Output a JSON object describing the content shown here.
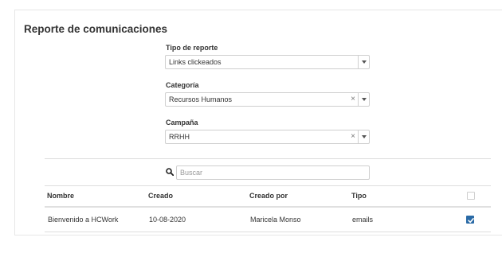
{
  "page": {
    "title": "Reporte de comunicaciones"
  },
  "filters": {
    "report_type": {
      "label": "Tipo de reporte",
      "value": "Links clickeados"
    },
    "category": {
      "label": "Categoría",
      "value": "Recursos Humanos",
      "clear": "×"
    },
    "campaign": {
      "label": "Campaña",
      "value": "RRHH",
      "clear": "×"
    }
  },
  "search": {
    "placeholder": "Buscar",
    "value": ""
  },
  "table": {
    "columns": [
      "Nombre",
      "Creado",
      "Creado por",
      "Tipo"
    ],
    "rows": [
      {
        "name": "Bienvenido a HCWork",
        "created": "10-08-2020",
        "created_by": "Maricela Monso",
        "type": "emails",
        "selected": true
      }
    ],
    "select_all": false
  },
  "colors": {
    "accent": "#2a6aa6",
    "border": "#cfcfcf",
    "text": "#333333"
  },
  "icons": {
    "search": "search-icon",
    "dropdown": "chevron-down-icon",
    "clear": "close-icon",
    "check": "check-icon"
  }
}
